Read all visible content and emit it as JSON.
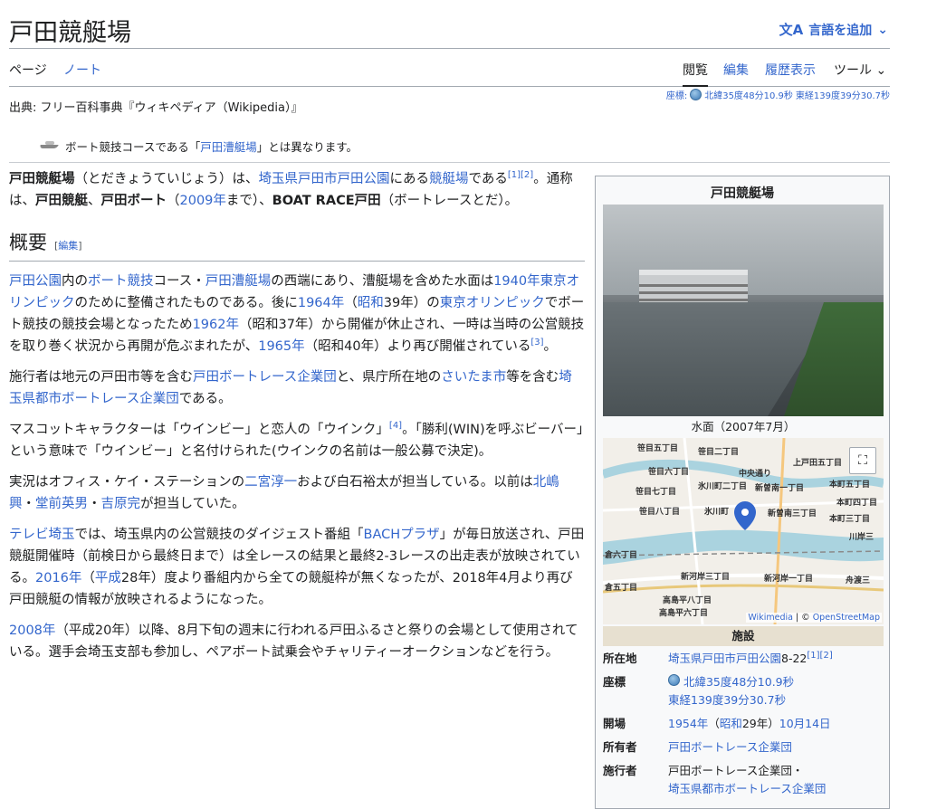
{
  "title": "戸田競艇場",
  "lang_button": "言語を追加",
  "tabs": {
    "page": "ページ",
    "note": "ノート",
    "read": "閲覧",
    "edit": "編集",
    "history": "履歴表示",
    "tools": "ツール"
  },
  "coords_top": {
    "label": "座標:",
    "lat": "北緯35度48分10.9秒",
    "lon": "東経139度39分30.7秒"
  },
  "from_line": "出典: フリー百科事典『ウィキペディア（Wikipedia）』",
  "hatnote": {
    "pre": "ボート競技コースである「",
    "link": "戸田漕艇場",
    "post": "」とは異なります。"
  },
  "intro": {
    "bold1": "戸田競艇場",
    "t1": "（とだきょうていじょう）は、",
    "l1": "埼玉県",
    "l2": "戸田市",
    "l3": "戸田公園",
    "t2": "にある",
    "l4": "競艇場",
    "t3": "である",
    "ref": "[1][2]",
    "t4": "。通称は、",
    "bold2": "戸田競艇",
    "t5": "、",
    "bold3": "戸田ボート",
    "t6": "（",
    "l5": "2009年",
    "t7": "まで）、",
    "bold4": "BOAT RACE戸田",
    "t8": "（ボートレースとだ）。"
  },
  "section": {
    "heading": "概要",
    "edit_open": "[",
    "edit_label": "編集",
    "edit_close": "]"
  },
  "p1": {
    "l1": "戸田公園",
    "t1": "内の",
    "l2": "ボート競技",
    "t2": "コース・",
    "l3": "戸田漕艇場",
    "t3": "の西端にあり、漕艇場を含めた水面は",
    "l4": "1940年東京オリンピック",
    "t4": "のために整備されたものである。後に",
    "l5": "1964年",
    "t5": "（",
    "l6": "昭和",
    "t6": "39年）の",
    "l7": "東京オリンピック",
    "t7": "でボート競技の競技会場となったため",
    "l8": "1962年",
    "t8": "（昭和37年）から開催が休止され、一時は当時の公営競技を取り巻く状況から再開が危ぶまれたが、",
    "l9": "1965年",
    "t9": "（昭和40年）より再び開催されている",
    "ref": "[3]",
    "t10": "。"
  },
  "p2": {
    "t1": "施行者は地元の戸田市等を含む",
    "l1": "戸田ボートレース企業団",
    "t2": "と、県庁所在地の",
    "l2": "さいたま市",
    "t3": "等を含む",
    "l3": "埼玉県都市ボートレース企業団",
    "t4": "である。"
  },
  "p3": {
    "t1": "マスコットキャラクターは「ウインビー」と恋人の「ウインク」",
    "ref": "[4]",
    "t2": "。「勝利(WIN)を呼ぶビーバー」という意味で「ウインビー」と名付けられた(ウインクの名前は一般公募で決定)。"
  },
  "p4": {
    "t1": "実況はオフィス・ケイ・ステーションの",
    "l1": "二宮淳一",
    "t2": "および白石裕太が担当している。以前は",
    "l2": "北嶋興",
    "t3": "・",
    "l3": "堂前英男",
    "t4": "・",
    "l4": "吉原完",
    "t5": "が担当していた。"
  },
  "p5": {
    "l1": "テレビ埼玉",
    "t1": "では、埼玉県内の公営競技のダイジェスト番組「",
    "l2": "BACHプラザ",
    "t2": "」が毎日放送され、戸田競艇開催時（前検日から最終日まで）は全レースの結果と最終2-3レースの出走表が放映されている。",
    "l3": "2016年",
    "t3": "（",
    "l4": "平成",
    "t4": "28年）度より番組内から全ての競艇枠が無くなったが、2018年4月より再び戸田競艇の情報が放映されるようになった。"
  },
  "p6": {
    "l1": "2008年",
    "t1": "（平成20年）以降、8月下旬の週末に行われる戸田ふるさと祭りの会場として使用されている。選手会埼玉支部も参加し、ペアボート試乗会やチャリティーオークションなどを行う。"
  },
  "infobox": {
    "title": "戸田競艇場",
    "photo_caption": "水面（2007年7月）",
    "map_labels": [
      "笹目五丁目",
      "笹目二丁目",
      "笹目六丁目",
      "上戸田五丁目",
      "中央通り",
      "笹目七丁目",
      "氷川町二丁目",
      "新曽南一丁目",
      "本町五丁目",
      "本町四丁目",
      "笹目八丁目",
      "氷川町",
      "新曽南三丁目",
      "本町三丁目",
      "川岸三",
      "倉六丁目",
      "新河岸三丁目",
      "新河岸一丁目",
      "舟渡三",
      "倉五丁目",
      "高島平八丁目",
      "高島平六丁目"
    ],
    "map_attr_wiki": "Wikimedia",
    "map_attr_sep": " | © ",
    "map_attr_osm": "OpenStreetMap",
    "facility_header": "施設",
    "rows": {
      "location_key": "所在地",
      "location_val": "埼玉県戸田市戸田公園",
      "location_num": "8-22",
      "location_ref": "[1][2]",
      "coord_key": "座標",
      "coord_lat": "北緯35度48分10.9秒",
      "coord_lon": "東経139度39分30.7秒",
      "open_key": "開場",
      "open_l1": "1954年",
      "open_t1": "（",
      "open_l2": "昭和",
      "open_t2": "29年）",
      "open_l3": "10月14日",
      "owner_key": "所有者",
      "owner_val": "戸田ボートレース企業団",
      "op_key": "施行者",
      "op_val1": "戸田ボートレース企業団・",
      "op_val2": "埼玉県都市ボートレース企業団"
    }
  },
  "colors": {
    "link": "#3366cc",
    "text": "#202122",
    "border": "#a2a9b1",
    "infobox_bg": "#f8f9fa",
    "header_bg": "#e7e0d0"
  }
}
